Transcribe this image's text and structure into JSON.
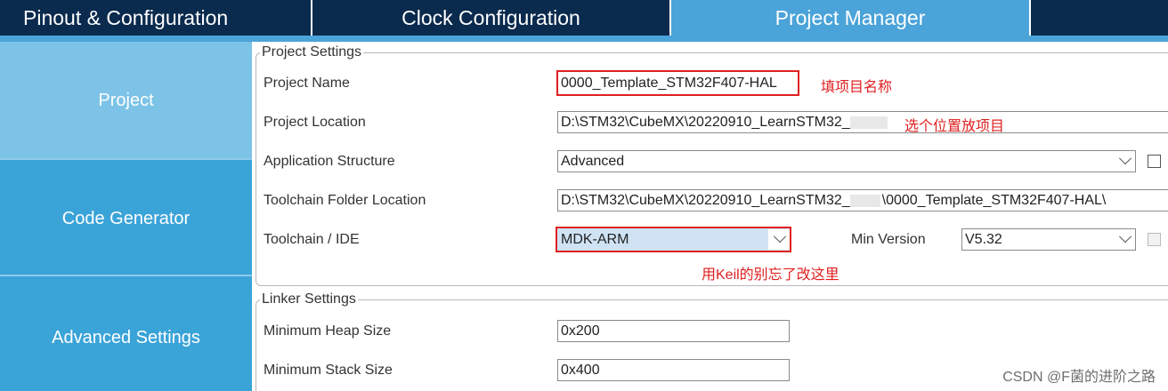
{
  "tabs": [
    {
      "label": "Pinout & Configuration"
    },
    {
      "label": "Clock Configuration"
    },
    {
      "label": "Project Manager"
    }
  ],
  "sidebar": {
    "items": [
      {
        "label": "Project"
      },
      {
        "label": "Code Generator"
      },
      {
        "label": "Advanced Settings"
      }
    ]
  },
  "project_settings": {
    "group_title": "Project Settings",
    "project_name": {
      "label": "Project Name",
      "value": "0000_Template_STM32F407-HAL"
    },
    "project_location": {
      "label": "Project Location",
      "value": "D:\\STM32\\CubeMX\\20220910_LearnSTM32_"
    },
    "application_structure": {
      "label": "Application Structure",
      "value": "Advanced"
    },
    "toolchain_folder": {
      "label": "Toolchain Folder Location",
      "value_prefix": "D:\\STM32\\CubeMX\\20220910_LearnSTM32_",
      "value_suffix": "\\0000_Template_STM32F407-HAL\\"
    },
    "toolchain_ide": {
      "label": "Toolchain / IDE",
      "value": "MDK-ARM"
    },
    "min_version": {
      "label": "Min Version",
      "value": "V5.32"
    }
  },
  "linker_settings": {
    "group_title": "Linker Settings",
    "heap": {
      "label": "Minimum Heap Size",
      "value": "0x200"
    },
    "stack": {
      "label": "Minimum Stack Size",
      "value": "0x400"
    }
  },
  "annotations": {
    "name_note": "填项目名称",
    "location_note": "选个位置放项目",
    "ide_note": "用Keil的别忘了改这里"
  },
  "watermark": "CSDN @F菌的进阶之路",
  "colors": {
    "topbar": "#0a2a4e",
    "accent": "#4aa3d9",
    "sidebar": "#3aa3d8",
    "sidebar_selected": "#7cc3e7",
    "annotation_red": "#e02020"
  }
}
